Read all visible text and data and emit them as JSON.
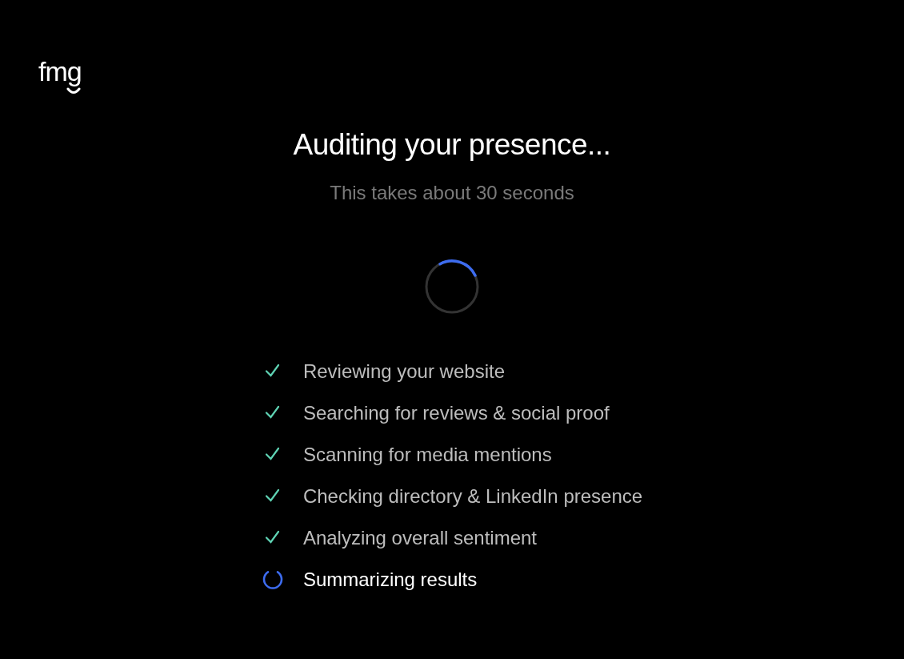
{
  "logo": {
    "text": "fmg"
  },
  "title": "Auditing your presence...",
  "subtitle": "This takes about 30 seconds",
  "steps": [
    {
      "label": "Reviewing your website",
      "done": true
    },
    {
      "label": "Searching for reviews & social proof",
      "done": true
    },
    {
      "label": "Scanning for media mentions",
      "done": true
    },
    {
      "label": "Checking directory & LinkedIn presence",
      "done": true
    },
    {
      "label": "Analyzing overall sentiment",
      "done": true
    },
    {
      "label": "Summarizing results",
      "done": false
    }
  ]
}
